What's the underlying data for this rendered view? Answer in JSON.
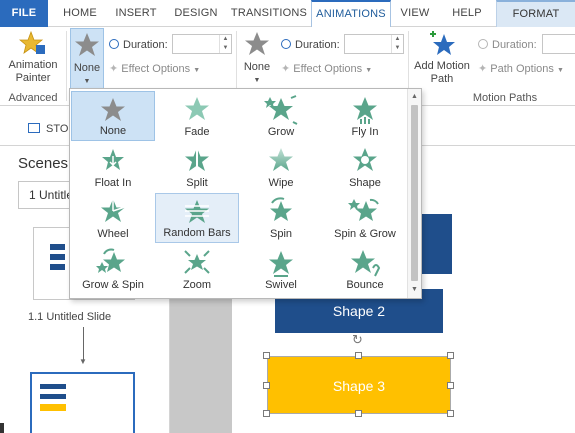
{
  "tabs": {
    "file": "FILE",
    "home": "HOME",
    "insert": "INSERT",
    "design": "DESIGN",
    "transitions": "TRANSITIONS",
    "animations": "ANIMATIONS",
    "view": "VIEW",
    "help": "HELP",
    "format": "FORMAT"
  },
  "ribbon": {
    "animation_painter": "Animation\nPainter",
    "advanced_label": "Advanced",
    "entrance_none": "None",
    "exit_none": "None",
    "duration_label": "Duration:",
    "duration_label2": "Duration:",
    "duration_label3": "Duration:",
    "effect_options": "Effect Options",
    "effect_options2": "Effect Options",
    "add_motion_path": "Add Motion\nPath",
    "path_options": "Path Options",
    "motion_paths_label": "Motion Paths"
  },
  "strip": {
    "story_label": "STORY"
  },
  "scenes": {
    "title": "Scenes",
    "selected": "1 Untitled",
    "slide_caption": "1.1 Untitled Slide"
  },
  "canvas": {
    "shape2": "Shape 2",
    "shape3": "Shape 3"
  },
  "gallery": {
    "items": [
      "None",
      "Fade",
      "Grow",
      "Fly In",
      "Float In",
      "Split",
      "Wipe",
      "Shape",
      "Wheel",
      "Random Bars",
      "Spin",
      "Spin & Grow",
      "Grow & Spin",
      "Zoom",
      "Swivel",
      "Bounce"
    ],
    "selected": "None",
    "hovered": "Random Bars"
  },
  "colors": {
    "accent": "#2b6bbd",
    "star_green": "#5aa58b",
    "star_gray": "#8c8c8c",
    "shape_blue": "#1f4e8b",
    "shape_yellow": "#ffc000",
    "selection": "#cde2f5"
  }
}
